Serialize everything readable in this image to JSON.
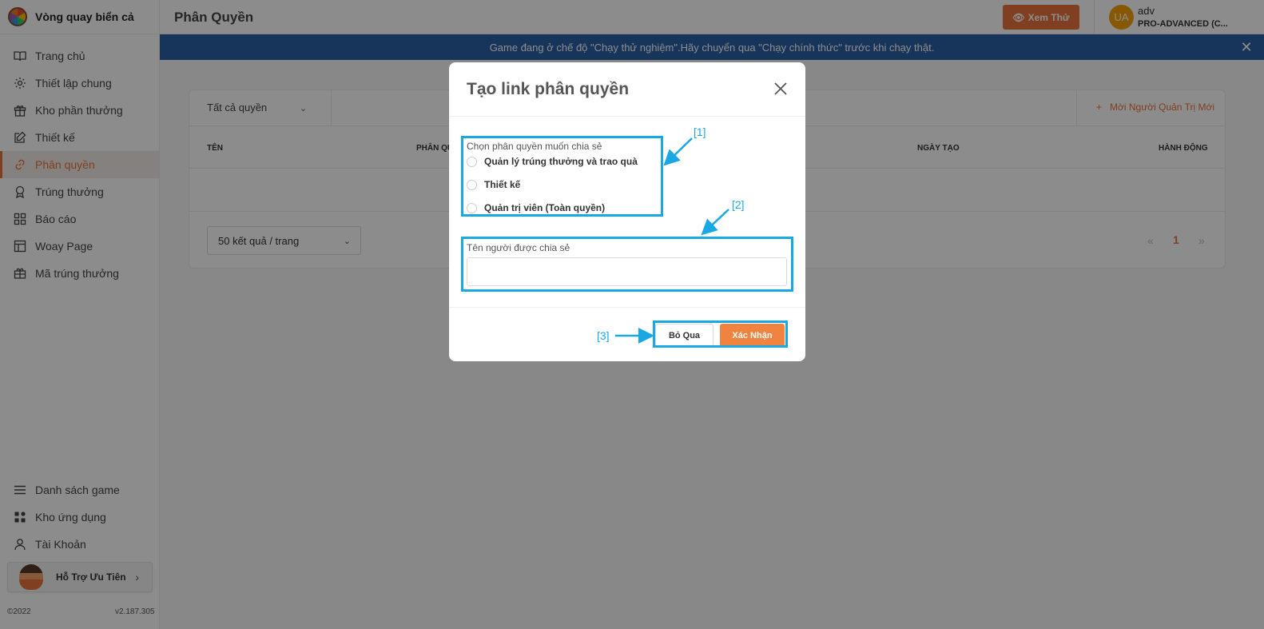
{
  "brand": {
    "title": "Vòng quay biển cả"
  },
  "sidebar": {
    "items": [
      {
        "label": "Trang chủ",
        "icon": "book-icon"
      },
      {
        "label": "Thiết lập chung",
        "icon": "gear-icon"
      },
      {
        "label": "Kho phần thưởng",
        "icon": "gift-icon"
      },
      {
        "label": "Thiết kế",
        "icon": "edit-icon"
      },
      {
        "label": "Phân quyền",
        "icon": "link-icon",
        "active": true
      },
      {
        "label": "Trúng thưởng",
        "icon": "award-icon"
      },
      {
        "label": "Báo cáo",
        "icon": "grid-icon"
      },
      {
        "label": "Woay Page",
        "icon": "layout-icon"
      },
      {
        "label": "Mã trúng thưởng",
        "icon": "ticket-icon"
      }
    ],
    "bottom_items": [
      {
        "label": "Danh sách game",
        "icon": "list-icon"
      },
      {
        "label": "Kho ứng dụng",
        "icon": "apps-icon"
      },
      {
        "label": "Tài Khoản",
        "icon": "user-icon"
      }
    ],
    "support_label": "Hỗ Trợ Ưu Tiên",
    "copyright": "©2022",
    "version": "v2.187.305"
  },
  "header": {
    "title": "Phân Quyền",
    "preview_label": "Xem Thử",
    "user_initials": "UA",
    "user_name": "adv",
    "user_plan": "PRO-ADVANCED (C..."
  },
  "banner": {
    "text": "Game đang ở chế độ \"Chạy thử nghiệm\".Hãy chuyển qua \"Chạy chính thức\" trước khi chạy thật."
  },
  "table": {
    "filter_value": "Tất cả quyền",
    "add_label": "Mời Người Quản Trị Mới",
    "columns": [
      "TÊN",
      "PHÂN QU",
      "NGÀY TẠO",
      "HÀNH ĐỘNG"
    ],
    "page_size": "50 kết quả / trang",
    "prev": "«",
    "page": "1",
    "next": "»"
  },
  "modal": {
    "title": "Tạo link phân quyền",
    "field1_label": "Chọn phân quyền muốn chia sẻ",
    "options": [
      "Quản lý trúng thưởng và trao quà",
      "Thiết kế",
      "Quản trị viên (Toàn quyền)"
    ],
    "field2_label": "Tên người được chia sẻ",
    "name_value": "",
    "skip_label": "Bỏ Qua",
    "confirm_label": "Xác Nhận"
  },
  "annotations": {
    "a1": "[1]",
    "a2": "[2]",
    "a3": "[3]",
    "color": "#18a8e6"
  },
  "colors": {
    "accent": "#e8743b",
    "banner": "#2a5fa5"
  }
}
